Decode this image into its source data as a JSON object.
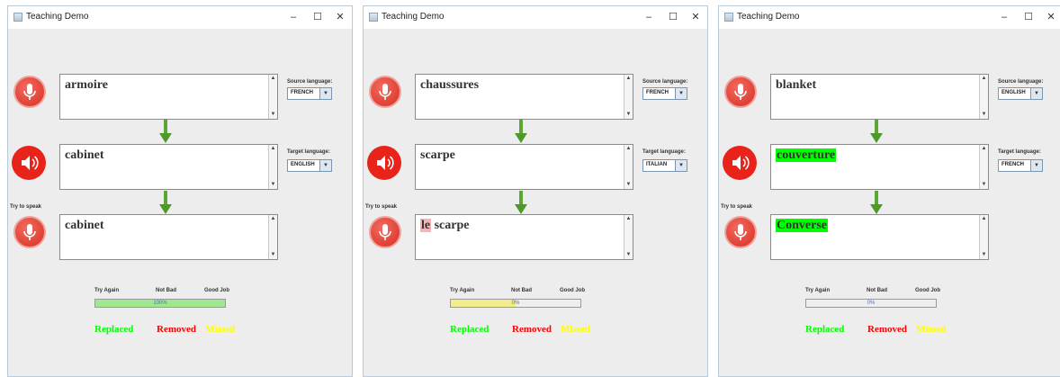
{
  "colors": {
    "replaced": "#00ff00",
    "removed": "#ff0000",
    "missed": "#ffff00",
    "progress_green": "#9ee98f",
    "progress_yellow": "#f3ec8c",
    "highlight_removed": "#f6b5b5",
    "highlight_replaced": "#00ff00"
  },
  "windows": [
    {
      "title": "Teaching Demo",
      "controls": {
        "minimize": "–",
        "maximize": "☐",
        "close": "✕"
      },
      "source_text": [
        {
          "text": "armoire",
          "hl": ""
        }
      ],
      "target_text": [
        {
          "text": "cabinet",
          "hl": ""
        }
      ],
      "spoken_text": [
        {
          "text": "cabinet",
          "hl": ""
        }
      ],
      "source_label": "Source language:",
      "source_language": "FRENCH",
      "target_label": "Target language:",
      "target_language": "ENGLISH",
      "try_to_speak": "Try to speak",
      "scale": {
        "try_again": "Try Again",
        "not_bad": "Not Bad",
        "good_job": "Good Job"
      },
      "progress": {
        "value": 1.0,
        "text": "100%",
        "color": "progress_green"
      },
      "legend": {
        "replaced": "Replaced",
        "removed": "Removed",
        "missed": "Missed"
      },
      "icons": {
        "mic1": "microphone-icon",
        "speaker": "speaker-icon",
        "mic2": "microphone-icon",
        "arrow": "down-arrow-icon"
      }
    },
    {
      "title": "Teaching Demo",
      "controls": {
        "minimize": "–",
        "maximize": "☐",
        "close": "✕"
      },
      "source_text": [
        {
          "text": "chaussures",
          "hl": ""
        }
      ],
      "target_text": [
        {
          "text": "scarpe",
          "hl": ""
        }
      ],
      "spoken_text": [
        {
          "text": "le",
          "hl": "highlight_removed"
        },
        {
          "text": " scarpe",
          "hl": ""
        }
      ],
      "source_label": "Source language:",
      "source_language": "FRENCH",
      "target_label": "Target language:",
      "target_language": "ITALIAN",
      "try_to_speak": "Try to speak",
      "scale": {
        "try_again": "Try Again",
        "not_bad": "Not Bad",
        "good_job": "Good Job"
      },
      "progress": {
        "value": 0.5,
        "text": "0%",
        "color": "progress_yellow"
      },
      "legend": {
        "replaced": "Replaced",
        "removed": "Removed",
        "missed": "Missed"
      },
      "icons": {
        "mic1": "microphone-icon",
        "speaker": "speaker-icon",
        "mic2": "microphone-icon",
        "arrow": "down-arrow-icon"
      }
    },
    {
      "title": "Teaching Demo",
      "controls": {
        "minimize": "–",
        "maximize": "☐",
        "close": "✕"
      },
      "source_text": [
        {
          "text": "blanket",
          "hl": ""
        }
      ],
      "target_text": [
        {
          "text": "couverture",
          "hl": "highlight_replaced"
        }
      ],
      "spoken_text": [
        {
          "text": "Converse",
          "hl": "highlight_replaced"
        }
      ],
      "source_label": "Source language:",
      "source_language": "ENGLISH",
      "target_label": "Target language:",
      "target_language": "FRENCH",
      "try_to_speak": "Try to speak",
      "scale": {
        "try_again": "Try Again",
        "not_bad": "Not Bad",
        "good_job": "Good Job"
      },
      "progress": {
        "value": 0.0,
        "text": "0%",
        "color": "progress_yellow"
      },
      "legend": {
        "replaced": "Replaced",
        "removed": "Removed",
        "missed": "Missed"
      },
      "icons": {
        "mic1": "microphone-icon",
        "speaker": "speaker-icon",
        "mic2": "microphone-icon",
        "arrow": "down-arrow-icon"
      }
    }
  ]
}
